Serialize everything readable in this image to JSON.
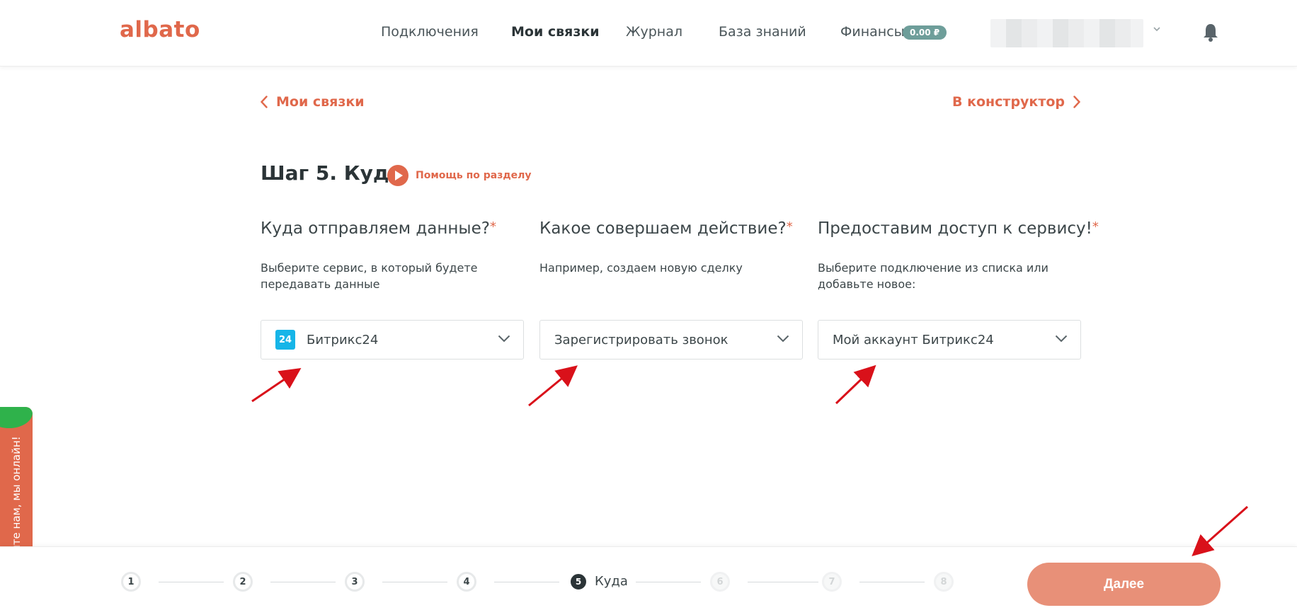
{
  "header": {
    "logo": "albato",
    "nav": [
      {
        "label": "Подключения",
        "active": false
      },
      {
        "label": "Мои связки",
        "active": true
      },
      {
        "label": "Журнал",
        "active": false
      },
      {
        "label": "База знаний",
        "active": false
      },
      {
        "label": "Финансы",
        "active": false
      }
    ],
    "balance_badge": "0.00 ₽",
    "icons": [
      "account-chevron-icon",
      "bell-icon"
    ]
  },
  "breadcrumb": {
    "back_label": "Мои связки",
    "forward_label": "В конструктор"
  },
  "page": {
    "title": "Шаг 5. Куда",
    "help_label": "Помощь по разделу"
  },
  "columns": [
    {
      "question": "Куда отправляем данные?",
      "hint": "Выберите сервис, в который будете передавать данные",
      "selected": "Битрикс24",
      "icon_text": "24"
    },
    {
      "question": "Какое совершаем действие?",
      "hint": "Например, создаем новую сделку",
      "selected": "Зарегистрировать звонок"
    },
    {
      "question": "Предоставим доступ к сервису!",
      "hint": "Выберите подключение из списка или добавьте новое:",
      "selected": "Мой аккаунт Битрикс24"
    }
  ],
  "required_mark": "*",
  "chat": {
    "label": "Напишите нам, мы онлайн!"
  },
  "stepper": {
    "steps": [
      "1",
      "2",
      "3",
      "4",
      "5",
      "6",
      "7",
      "8"
    ],
    "current_step": 5,
    "current_label": "Куда",
    "next_button": "Далее"
  },
  "colors": {
    "accent": "#e0684b",
    "button": "#e89078",
    "badge": "#6e9e9a",
    "annotation_arrow": "#d9111a",
    "bitrix": "#16b5e8"
  }
}
